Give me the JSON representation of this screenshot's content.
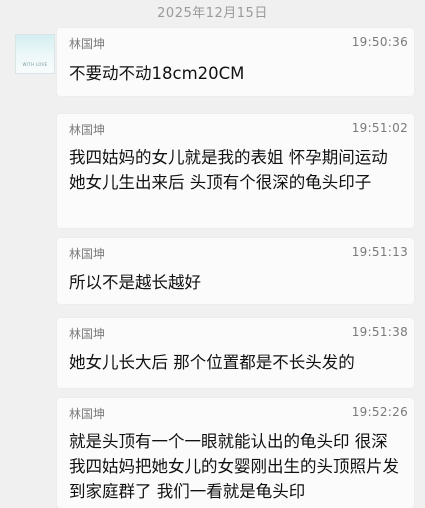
{
  "date_header": "2025年12月15日",
  "avatar": {
    "caption": "WITH LOVE"
  },
  "messages": [
    {
      "sender": "林国坤",
      "time": "19:50:36",
      "text": "不要动不动18cm20CM"
    },
    {
      "sender": "林国坤",
      "time": "19:51:02",
      "text": "我四姑妈的女儿就是我的表姐 怀孕期间运动 她女儿生出来后 头顶有个很深的龟头印子"
    },
    {
      "sender": "林国坤",
      "time": "19:51:13",
      "text": "所以不是越长越好"
    },
    {
      "sender": "林国坤",
      "time": "19:51:38",
      "text": "她女儿长大后 那个位置都是不长头发的"
    },
    {
      "sender": "林国坤",
      "time": "19:52:26",
      "text": "就是头顶有一个一眼就能认出的龟头印 很深 我四姑妈把她女儿的女婴刚出生的头顶照片发到家庭群了 我们一看就是龟头印"
    }
  ]
}
